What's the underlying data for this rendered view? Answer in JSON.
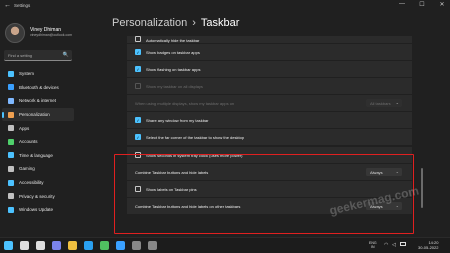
{
  "titlebar": {
    "back": "←",
    "title": "Settings",
    "controls": [
      "—",
      "☐",
      "✕"
    ]
  },
  "user": {
    "name": "Viney Dhiman",
    "email": "vineydhiman@outlook.com"
  },
  "search": {
    "placeholder": "Find a setting",
    "icon": "🔍"
  },
  "nav": [
    {
      "label": "System",
      "icon_color": "#4cc2ff"
    },
    {
      "label": "Bluetooth & devices",
      "icon_color": "#3aa0ff"
    },
    {
      "label": "Network & internet",
      "icon_color": "#7fb8ff"
    },
    {
      "label": "Personalization",
      "icon_color": "#f0a050",
      "active": true
    },
    {
      "label": "Apps",
      "icon_color": "#c0c0c0"
    },
    {
      "label": "Accounts",
      "icon_color": "#4fd06b"
    },
    {
      "label": "Time & language",
      "icon_color": "#4cc2ff"
    },
    {
      "label": "Gaming",
      "icon_color": "#c0c0c0"
    },
    {
      "label": "Accessibility",
      "icon_color": "#4cc2ff"
    },
    {
      "label": "Privacy & security",
      "icon_color": "#c0c0c0"
    },
    {
      "label": "Windows Update",
      "icon_color": "#4cc2ff"
    }
  ],
  "breadcrumb": {
    "parent": "Personalization",
    "sep": "›",
    "current": "Taskbar"
  },
  "rows": {
    "r0": "Automatically hide the taskbar",
    "r1": "Show badges on taskbar apps",
    "r2": "Show flashing on taskbar apps",
    "r3": "Show my taskbar on all displays",
    "r4": "When using multiple displays, show my taskbar apps on",
    "r4_dropdown": "All taskbars",
    "r5": "Share any window from my taskbar",
    "r6": "Select the far corner of the taskbar to show the desktop",
    "r7": "Show seconds in system tray clock (uses more power)",
    "r8": "Combine Taskbar buttons and hide labels",
    "r8_dropdown": "Always",
    "r9": "Show labels on Taskbar pins",
    "r10": "Combine Taskbar buttons and hide labels on other taskbars",
    "r10_dropdown": "Always"
  },
  "watermark": "geekermag.com",
  "taskbar": {
    "icon_colors": [
      "#4cc2ff",
      "#dddddd",
      "#dddddd",
      "#7b83eb",
      "#f0c040",
      "#2aa0f0",
      "#50c060",
      "#3aa0ff",
      "#888888",
      "#888888"
    ],
    "lang_line1": "ENG",
    "lang_line2": "IN",
    "time": "14:20",
    "date": "30-05-2022"
  },
  "colors": {
    "accent": "#4cc2ff",
    "highlight": "#e02020",
    "background": "#202020"
  }
}
